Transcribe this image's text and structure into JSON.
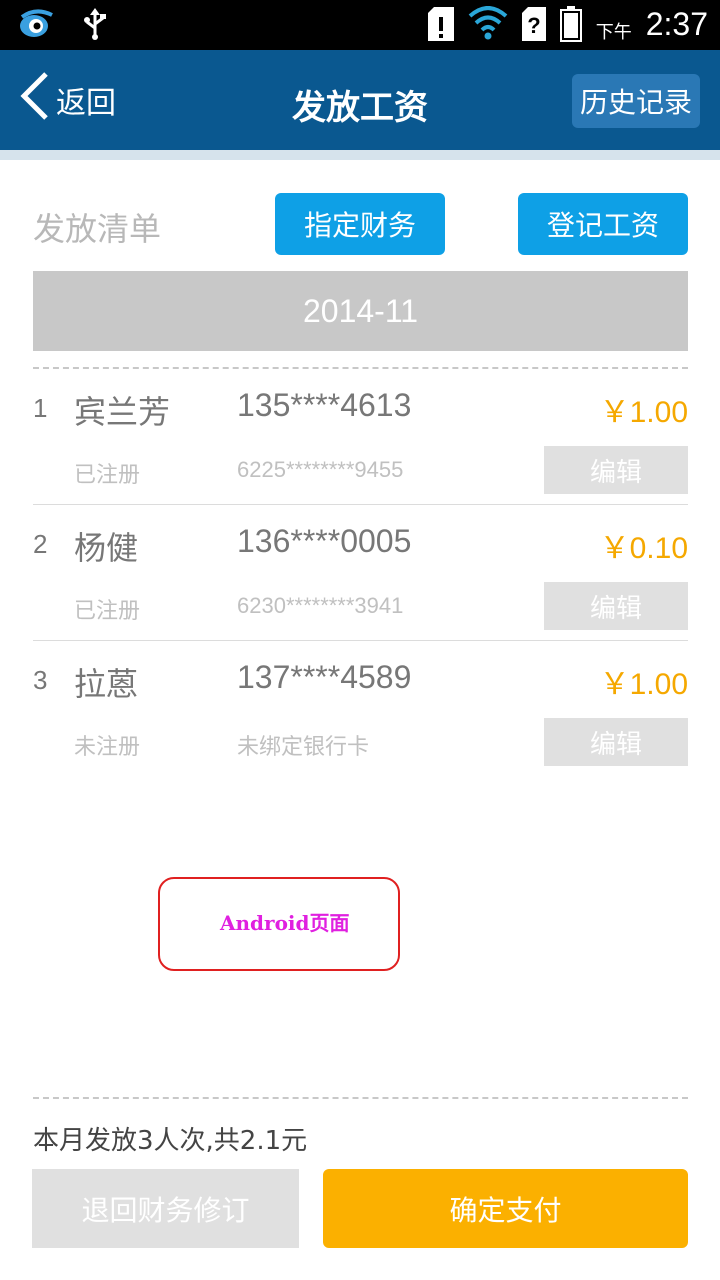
{
  "status_bar": {
    "ampm": "下午",
    "time": "2:37",
    "icons": [
      "app-bird-icon",
      "usb-icon",
      "sd-card-alert-icon",
      "wifi-icon",
      "sim-unknown-icon",
      "battery-icon"
    ]
  },
  "header": {
    "back_label": "返回",
    "title": "发放工资",
    "history_label": "历史记录"
  },
  "list": {
    "label": "发放清单",
    "assign_finance_label": "指定财务",
    "register_salary_label": "登记工资",
    "month": "2014-11",
    "edit_label": "编辑",
    "rows": [
      {
        "index": "1",
        "name": "宾兰芳",
        "phone": "135****4613",
        "amount": "￥1.00",
        "status": "已注册",
        "card": "6225********9455"
      },
      {
        "index": "2",
        "name": "杨健",
        "phone": "136****0005",
        "amount": "￥0.10",
        "status": "已注册",
        "card": "6230********3941"
      },
      {
        "index": "3",
        "name": "拉蒽",
        "phone": "137****4589",
        "amount": "￥1.00",
        "status": "未注册",
        "card": "未绑定银行卡"
      }
    ]
  },
  "annotation": {
    "text": "Android页面"
  },
  "footer": {
    "summary": "本月发放3人次,共2.1元",
    "revise_label": "退回财务修订",
    "pay_label": "确定支付"
  },
  "colors": {
    "header_bg": "#0a5890",
    "accent_blue": "#0ea0e6",
    "amount": "#f5a800",
    "pay_button": "#fbb000"
  }
}
